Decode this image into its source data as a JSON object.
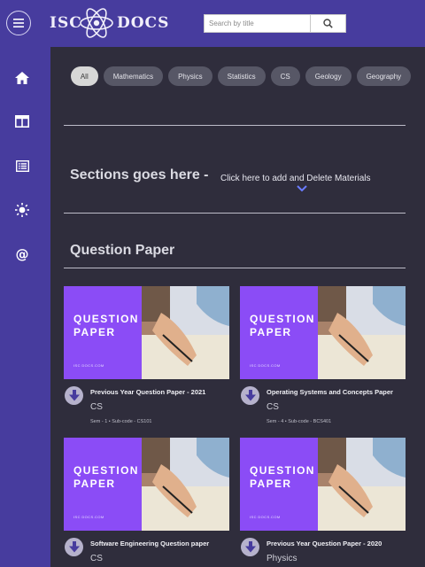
{
  "header": {
    "logo_left": "ISC",
    "logo_right": "DOCS",
    "search_placeholder": "Search by title",
    "menu_icon": "hamburger-icon",
    "search_icon": "search-icon"
  },
  "sidebar": {
    "items": [
      {
        "icon": "home-icon"
      },
      {
        "icon": "layout-icon"
      },
      {
        "icon": "list-icon"
      },
      {
        "icon": "brightness-icon"
      },
      {
        "icon": "at-icon"
      }
    ]
  },
  "filters": [
    "All",
    "Mathematics",
    "Physics",
    "Statistics",
    "CS",
    "Geology",
    "Geography"
  ],
  "sections": {
    "title": "Sections goes here -",
    "link": "Click here to add and Delete Materials"
  },
  "question_paper": {
    "heading": "Question Paper",
    "cards": [
      {
        "thumb_line1": "QUESTION",
        "thumb_line2": "PAPER",
        "thumb_site": "ISC DOCS.COM",
        "title": "Previous Year Question Paper - 2021",
        "subject": "CS",
        "meta": "Sem - 1  •  Sub-code - CS101"
      },
      {
        "thumb_line1": "QUESTION",
        "thumb_line2": "PAPER",
        "thumb_site": "ISC DOCS.COM",
        "title": "Operating Systems and Concepts Paper",
        "subject": "CS",
        "meta": "Sem - 4  •  Sub-code - BCS401"
      },
      {
        "thumb_line1": "QUESTION",
        "thumb_line2": "PAPER",
        "thumb_site": "ISC DOCS.COM",
        "title": "Software Engineering Question paper",
        "subject": "CS",
        "meta": ""
      },
      {
        "thumb_line1": "QUESTION",
        "thumb_line2": "PAPER",
        "thumb_site": "ISC DOCS.COM",
        "title": "Previous Year Question Paper - 2020",
        "subject": "Physics",
        "meta": ""
      }
    ]
  },
  "colors": {
    "brand": "#473c9e",
    "background": "#2f2d3c",
    "thumb_purple": "#8b4cf6",
    "chevron": "#6a7cff"
  }
}
